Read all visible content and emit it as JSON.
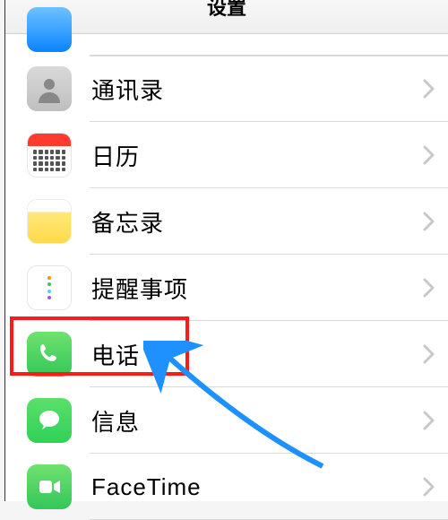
{
  "header": {
    "title": "设置"
  },
  "rows": [
    {
      "label": "通讯录",
      "icon_name": "contacts-icon"
    },
    {
      "label": "日历",
      "icon_name": "calendar-icon"
    },
    {
      "label": "备忘录",
      "icon_name": "notes-icon"
    },
    {
      "label": "提醒事项",
      "icon_name": "reminders-icon"
    },
    {
      "label": "电话",
      "icon_name": "phone-icon"
    },
    {
      "label": "信息",
      "icon_name": "messages-icon"
    },
    {
      "label": "FaceTime",
      "icon_name": "facetime-icon"
    }
  ],
  "annotations": {
    "highlighted_row_index": 4,
    "highlight_color": "#ff1a1a",
    "arrow_color": "#1e90ff"
  }
}
